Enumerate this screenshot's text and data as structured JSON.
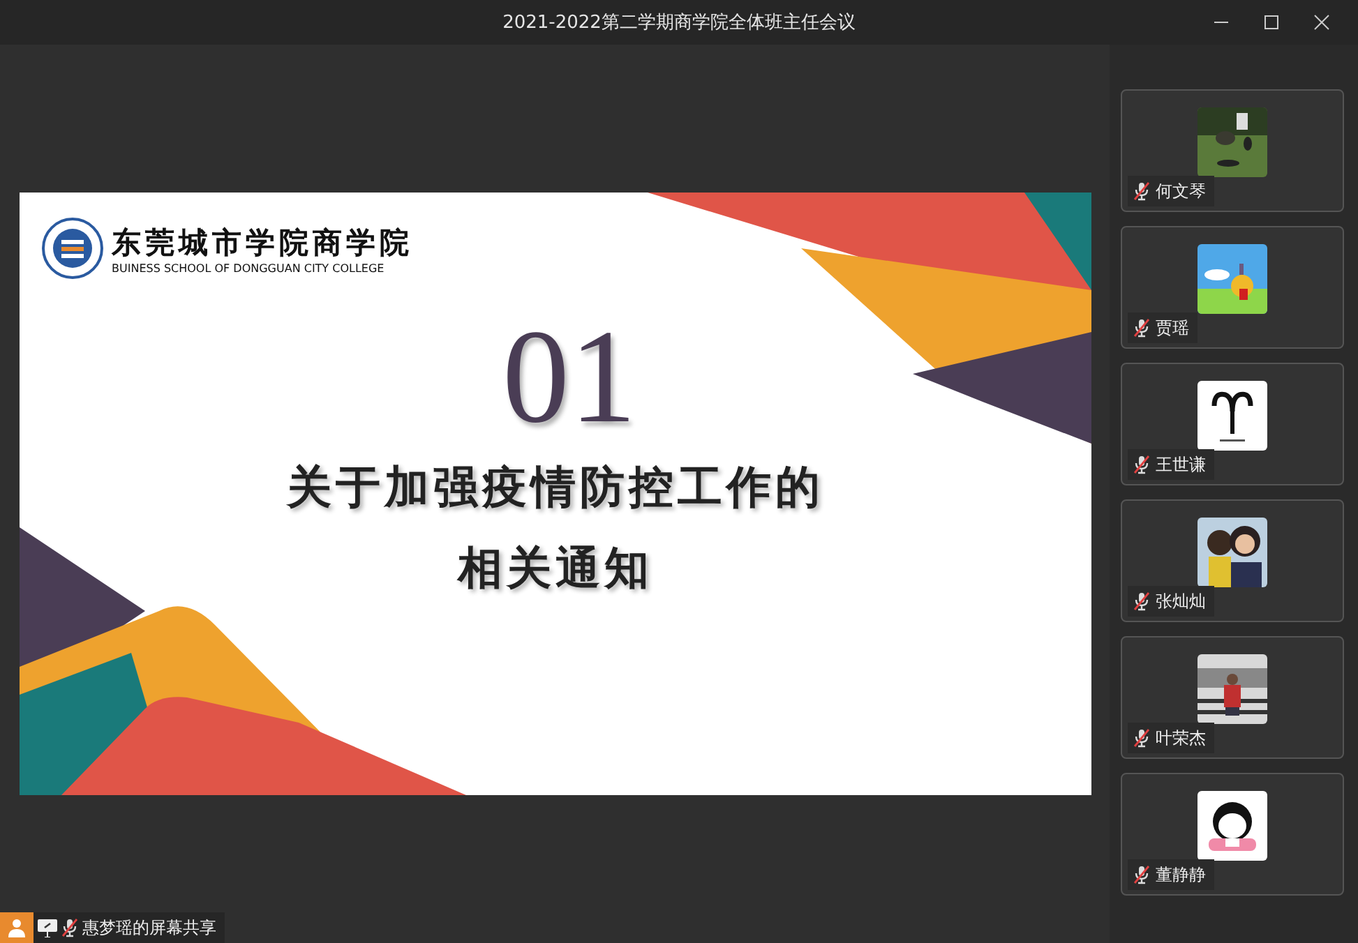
{
  "window": {
    "title": "2021-2022第二学期商学院全体班主任会议"
  },
  "slide": {
    "logo_name": "东莞城市学院商学院",
    "logo_subtitle": "BUINESS SCHOOL OF DONGGUAN CITY COLLEGE",
    "number": "01",
    "title_lines": [
      "关于加强疫情防控工作的",
      "相关通知"
    ]
  },
  "participants": [
    {
      "name": "何文琴",
      "muted": true
    },
    {
      "name": "贾瑶",
      "muted": true
    },
    {
      "name": "王世谦",
      "muted": true
    },
    {
      "name": "张灿灿",
      "muted": true
    },
    {
      "name": "叶荣杰",
      "muted": true
    },
    {
      "name": "董静静",
      "muted": true
    }
  ],
  "share_bar": {
    "label": "惠梦瑶的屏幕共享",
    "muted": true
  }
}
